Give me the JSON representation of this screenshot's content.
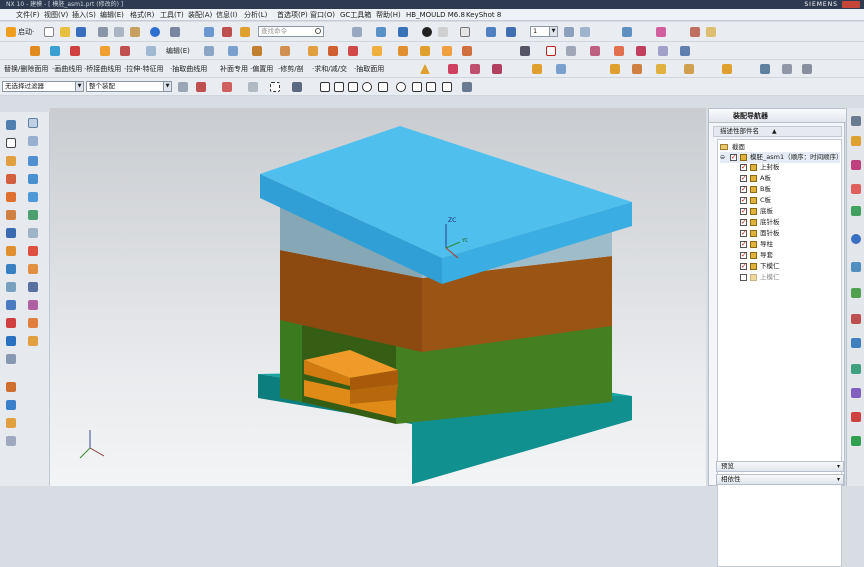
{
  "window": {
    "title": "NX 10 - 建模 - [ 模胚_asm1.prt (修改的) ]",
    "brand": "SIEMENS"
  },
  "menu": [
    "文件(F)",
    "视图(V)",
    "插入(S)",
    "编辑(E)",
    "格式(R)",
    "工具(T)",
    "装配(A)",
    "信息(I)",
    "分析(L)",
    "首选项(P)",
    "窗口(O)",
    "GC工具箱",
    "帮助(H)",
    "HB_MOULD M6.8",
    "KeyShot 8"
  ],
  "toolbar1": {
    "start_label": "启动·",
    "search_placeholder": "查找命令",
    "layer_value": "1"
  },
  "toolbar2": {
    "edit_label": "编辑(E)"
  },
  "toolbar3": {
    "items": [
      "替换/删除面用",
      "·画曲线用",
      "·桥接曲线用",
      "·拉伸·特征用",
      "·抽取曲线用",
      "补面专用",
      "·偏置用",
      "·修剪/剖",
      "·求和/减/交",
      "·抽取面用"
    ]
  },
  "selection": {
    "filter": "无选择过滤器",
    "scope": "整个装配"
  },
  "navigator": {
    "title": "装配导航器",
    "column": "描述性部件名",
    "root_section": "截面",
    "assembly": "模胚_asm1（顺序：时间顺序）",
    "parts": [
      {
        "name": "上封板",
        "checked": true
      },
      {
        "name": "A板",
        "checked": true
      },
      {
        "name": "B板",
        "checked": true
      },
      {
        "name": "C板",
        "checked": true
      },
      {
        "name": "底板",
        "checked": true
      },
      {
        "name": "底针板",
        "checked": true
      },
      {
        "name": "面针板",
        "checked": true
      },
      {
        "name": "导柱",
        "checked": true
      },
      {
        "name": "导套",
        "checked": true
      },
      {
        "name": "下模仁",
        "checked": true
      },
      {
        "name": "上模仁",
        "checked": false
      }
    ],
    "preview": "预览",
    "dependencies": "相依性"
  },
  "viewport": {
    "csys_z": "ZC",
    "csys_y": "YC",
    "colors": {
      "top_plate": "#4fc0ee",
      "a_plate": "#8fb3c6",
      "b_plate": "#8a4a10",
      "c_plate": "#3d7a24",
      "base_plate": "#0f8a8a",
      "ejector": "#d97a10"
    }
  }
}
